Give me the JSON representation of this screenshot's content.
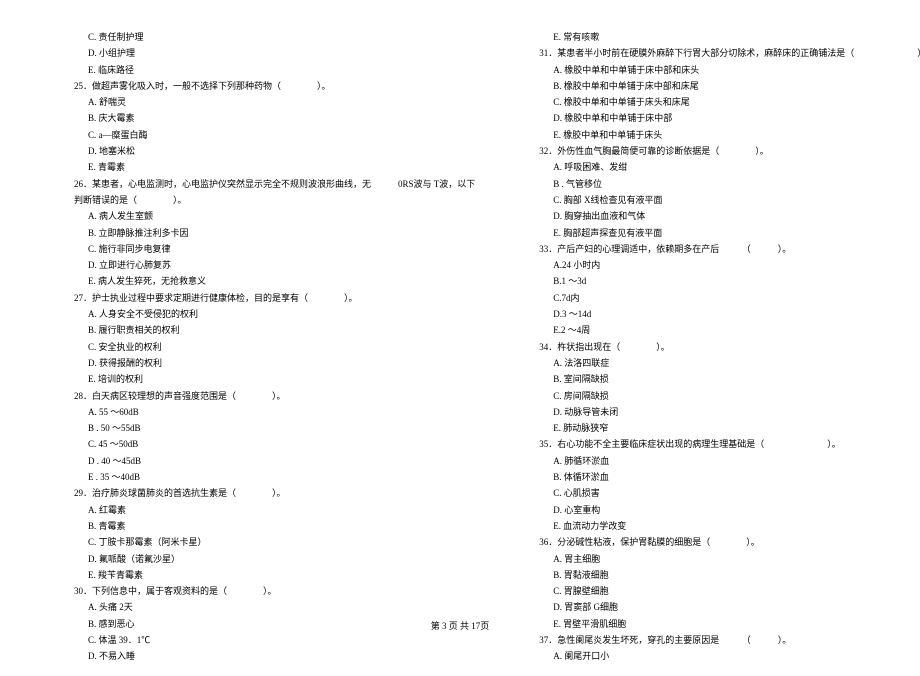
{
  "left": {
    "preA": [
      "C. 责任制护理",
      "D. 小组护理",
      "E. 临床路径"
    ],
    "q25": {
      "stem": "25．做超声雾化吸入时，一般不选择下列那种药物（　　　　）。",
      "opts": [
        "A.  舒喘灵",
        "B.  庆大霉素",
        "C.  a—糜蛋白酶",
        "D.  地塞米松",
        "E.  青霉素"
      ]
    },
    "q26": {
      "stem1": "26．某患者，心电监测时，心电监护仪突然显示完全不规则波浪形曲线，无　　　0RS波与 T波，以下",
      "stem2": "判断错误的是（　　　　）。",
      "opts": [
        "A. 病人发生室颤",
        "B. 立即静脉推注利多卡因",
        "C. 施行非同步电复律",
        "D. 立即进行心肺复苏",
        "E. 病人发生猝死，无抢救意义"
      ]
    },
    "q27": {
      "stem": "27．护士执业过程中要求定期进行健康体检，目的是享有（　　　　）。",
      "opts": [
        "A.  人身安全不受侵犯的权利",
        "B.  履行职责相关的权利",
        "C.  安全执业的权利",
        "D.  获得报酬的权利",
        "E.  培训的权利"
      ]
    },
    "q28": {
      "stem": "28．白天病区较理想的声音强度范围是（　　　　）。",
      "opts": [
        "A. 55 ～60dB",
        "B . 50 ～55dB",
        "C. 45 ～50dB",
        "D . 40 ～45dB",
        "E . 35 ～40dB"
      ]
    },
    "q29": {
      "stem": "29．治疗肺炎球菌肺炎的首选抗生素是（　　　　）。",
      "opts": [
        "A.  红霉素",
        "B.  青霉素",
        "C.  丁胺卡那霉素（阿米卡星）",
        "D.  氟哌酸（诺氟沙星）",
        "E.  羧苄青霉素"
      ]
    },
    "q30": {
      "stem": "30．下列信息中，属于客观资料的是（　　　　）。",
      "opts": [
        "A.  头痛 2天",
        "B.  感到恶心",
        "C.  体温 39．1℃",
        "D.  不易入睡"
      ]
    }
  },
  "right": {
    "preB": [
      "E.  常有咳嗽"
    ],
    "q31": {
      "stem": "31．某患者半小时前在硬膜外麻醉下行胃大部分切除术，麻醉床的正确铺法是（　　　　　　　）。",
      "opts": [
        "A. 橡胶中单和中单铺于床中部和床头",
        "B. 橡胶中单和中单铺于床中部和床尾",
        "C. 橡胶中单和中单铺于床头和床尾",
        "D. 橡胶中单和中单铺于床中部",
        "E. 橡胶中单和中单铺于床头"
      ]
    },
    "q32": {
      "stem": "32．外伤性血气胸最简便可靠的诊断依据是（　　　　）。",
      "opts": [
        "A.  呼吸困难、发绀",
        "B . 气管移位",
        "C.  胸部 X线检查见有液平面",
        "D.  胸穿抽出血液和气体",
        "E.  胸部超声探查见有液平面"
      ]
    },
    "q33": {
      "stem": "33．产后产妇的心理调适中，依赖期多在产后　　　（　　　）。",
      "opts": [
        "A.24 小时内",
        "B.1 ～3d",
        "C.7d内",
        "D.3 ～14d",
        "E.2 ～4周"
      ]
    },
    "q34": {
      "stem": "34．杵状指出现在（　　　　）。",
      "opts": [
        "A. 法洛四联症",
        "B. 室间隔缺损",
        "C. 房间隔缺损",
        "D. 动脉导管未闭",
        "E. 肺动脉狭窄"
      ]
    },
    "q35": {
      "stem": "35．右心功能不全主要临床症状出现的病理生理基础是（　　　　　　　）。",
      "opts": [
        "A.  肺循环淤血",
        "B.  体循环淤血",
        "C.  心肌损害",
        "D.  心室重构",
        "E.  血流动力学改变"
      ]
    },
    "q36": {
      "stem": "36．分泌碱性粘液，保护胃黏膜的细胞是（　　　　）。",
      "opts": [
        "A. 胃主细胞",
        "B. 胃黏液细胞",
        "C. 胃腺壁细胞",
        "D. 胃窦部 G细胞",
        "E. 胃壁平滑肌细胞"
      ]
    },
    "q37": {
      "stem": "37．急性阑尾炎发生坏死，穿孔的主要原因是　　　（　　　）。",
      "opts": [
        "A. 阑尾开口小"
      ]
    }
  },
  "footer": "第  3 页  共  17页"
}
